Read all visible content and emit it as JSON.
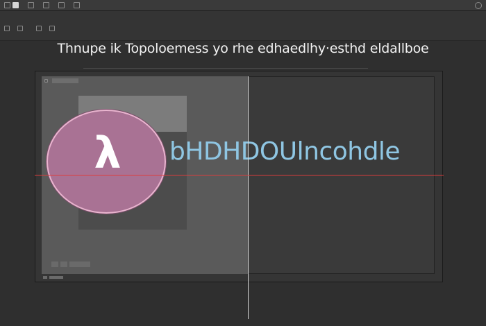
{
  "menubar": {
    "items": [
      "",
      "",
      "",
      "",
      ""
    ],
    "right_label": ""
  },
  "toolbar": {
    "items": [
      "",
      "",
      "",
      "",
      ""
    ]
  },
  "headline": "Thnupe ik Topoloemess yo rhe edhaedlhy·esthd eldallboe",
  "subbar": {
    "left": "",
    "right": ""
  },
  "panel": {
    "tab_label": ""
  },
  "logo": {
    "glyph": "λ",
    "color": "#a97294"
  },
  "overlay_text": "bHDHDOUlncohdle",
  "status": {
    "label": "",
    "value": ""
  },
  "colors": {
    "guide_horizontal": "#e03c3c",
    "guide_vertical": "#d9d9d9",
    "overlay_text": "#8fc6e3"
  }
}
